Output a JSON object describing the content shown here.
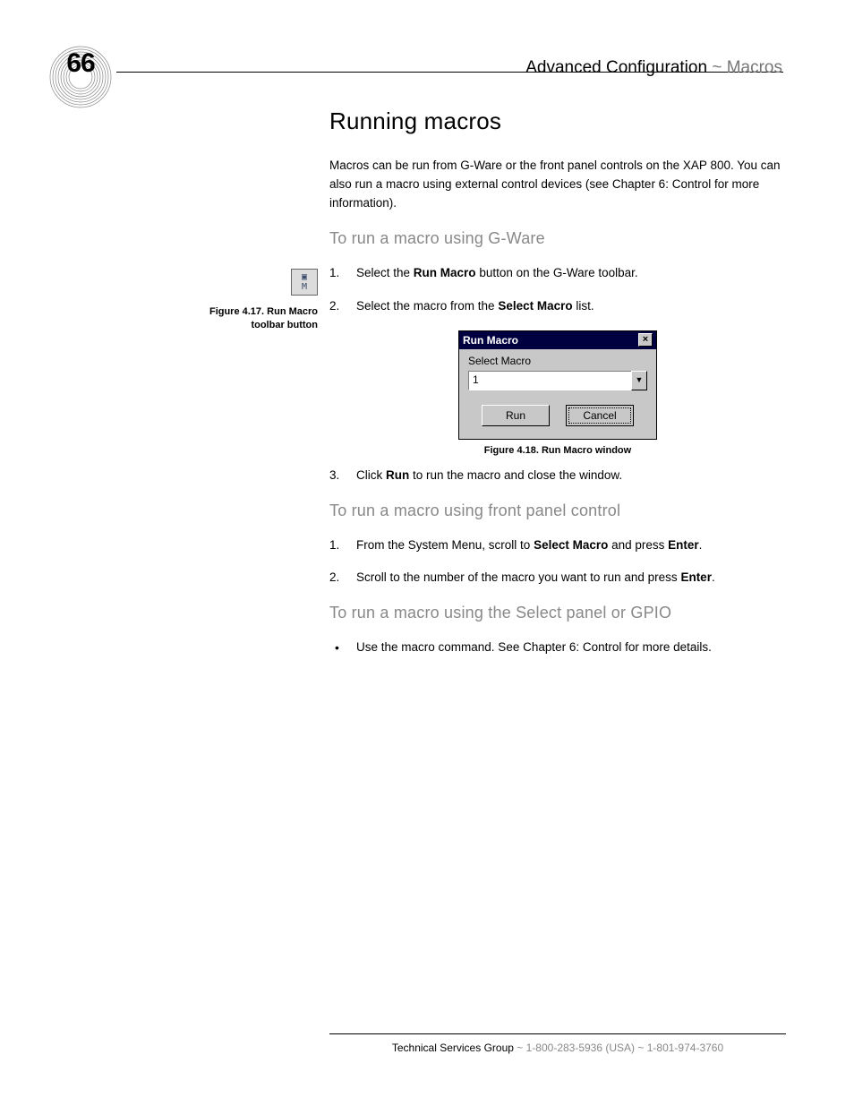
{
  "page_number": "66",
  "header": {
    "section": "Advanced Configuration",
    "sep": "~",
    "sub": "Macros"
  },
  "h1": "Running macros",
  "intro": "Macros can be run from G-Ware or the front panel controls on the XAP 800. You can also run a macro using external control devices (see Chapter 6: Control for more information).",
  "sec1": {
    "title": "To run a macro using G-Ware",
    "step1_a": "Select the ",
    "step1_b": "Run Macro",
    "step1_c": " button on the G-Ware toolbar.",
    "step2_a": "Select the macro from the ",
    "step2_b": "Select Macro",
    "step2_c": " list.",
    "step3_a": "Click ",
    "step3_b": "Run",
    "step3_c": " to run the macro and close the window."
  },
  "fig17": {
    "label": "Figure 4.17. Run Macro toolbar button"
  },
  "dialog": {
    "title": "Run Macro",
    "close": "×",
    "label": "Select Macro",
    "value": "1",
    "run": "Run",
    "cancel": "Cancel"
  },
  "fig18": {
    "label": "Figure 4.18. Run Macro window"
  },
  "sec2": {
    "title": "To run a macro using front panel control",
    "step1_a": "From the System Menu, scroll to ",
    "step1_b": "Select Macro",
    "step1_c": " and press ",
    "step1_d": "Enter",
    "step1_e": ".",
    "step2_a": "Scroll to the number of the macro you want to run and press ",
    "step2_b": "Enter",
    "step2_c": "."
  },
  "sec3": {
    "title": "To run a macro using the Select panel or GPIO",
    "bullet": "Use the macro command. See Chapter 6: Control for more details."
  },
  "footer": {
    "group": "Technical Services Group",
    "sep1": "~",
    "phone1": "1-800-283-5936 (USA)",
    "sep2": "~",
    "phone2": "1-801-974-3760"
  }
}
